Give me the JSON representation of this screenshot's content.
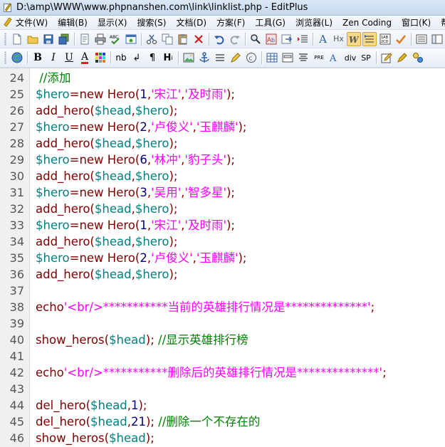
{
  "window": {
    "title": "D:\\amp\\WWW\\www.phpnanshen.com\\link\\linklist.php - EditPlus"
  },
  "menu": [
    "文件(W)",
    "编辑(B)",
    "显示(X)",
    "搜索(S)",
    "文档(D)",
    "方案(F)",
    "工具(G)",
    "浏览器(L)",
    "Zen Coding",
    "窗口(K)",
    "帮助"
  ],
  "toolbar_format": {
    "bold": "B",
    "italic": "I",
    "underline": "U",
    "font_color": "A",
    "nbsp": "nb",
    "break": "↲",
    "paragraph": "¶",
    "heading": "H",
    "pre": "PRE",
    "div": "div",
    "span": "SP",
    "hx": "Hx",
    "font_size": "A"
  },
  "editor": {
    "lines": [
      {
        "n": "24",
        "tokens": [
          {
            "t": " //添加",
            "c": "cmt"
          }
        ]
      },
      {
        "n": "25",
        "tokens": [
          {
            "t": "$hero",
            "c": "var"
          },
          {
            "t": "=",
            "c": "op"
          },
          {
            "t": "new Hero(",
            "c": "cls"
          },
          {
            "t": "1",
            "c": "num"
          },
          {
            "t": ",",
            "c": "op"
          },
          {
            "t": "'宋江'",
            "c": "str"
          },
          {
            "t": ",",
            "c": "op"
          },
          {
            "t": "'及时雨'",
            "c": "str"
          },
          {
            "t": ");",
            "c": "op"
          }
        ]
      },
      {
        "n": "26",
        "tokens": [
          {
            "t": "add_hero(",
            "c": "fn"
          },
          {
            "t": "$head",
            "c": "var"
          },
          {
            "t": ",",
            "c": "op"
          },
          {
            "t": "$hero",
            "c": "var"
          },
          {
            "t": ");",
            "c": "op"
          }
        ]
      },
      {
        "n": "27",
        "tokens": [
          {
            "t": "$hero",
            "c": "var"
          },
          {
            "t": "=",
            "c": "op"
          },
          {
            "t": "new Hero(",
            "c": "cls"
          },
          {
            "t": "2",
            "c": "num"
          },
          {
            "t": ",",
            "c": "op"
          },
          {
            "t": "'卢俊义'",
            "c": "str"
          },
          {
            "t": ",",
            "c": "op"
          },
          {
            "t": "'玉麒麟'",
            "c": "str"
          },
          {
            "t": ");",
            "c": "op"
          }
        ]
      },
      {
        "n": "28",
        "tokens": [
          {
            "t": "add_hero(",
            "c": "fn"
          },
          {
            "t": "$head",
            "c": "var"
          },
          {
            "t": ",",
            "c": "op"
          },
          {
            "t": "$hero",
            "c": "var"
          },
          {
            "t": ");",
            "c": "op"
          }
        ]
      },
      {
        "n": "29",
        "tokens": [
          {
            "t": "$hero",
            "c": "var"
          },
          {
            "t": "=",
            "c": "op"
          },
          {
            "t": "new Hero(",
            "c": "cls"
          },
          {
            "t": "6",
            "c": "num"
          },
          {
            "t": ",",
            "c": "op"
          },
          {
            "t": "'林冲'",
            "c": "str"
          },
          {
            "t": ",",
            "c": "op"
          },
          {
            "t": "'豹子头'",
            "c": "str"
          },
          {
            "t": ");",
            "c": "op"
          }
        ]
      },
      {
        "n": "30",
        "tokens": [
          {
            "t": "add_hero(",
            "c": "fn"
          },
          {
            "t": "$head",
            "c": "var"
          },
          {
            "t": ",",
            "c": "op"
          },
          {
            "t": "$hero",
            "c": "var"
          },
          {
            "t": ");",
            "c": "op"
          }
        ]
      },
      {
        "n": "31",
        "tokens": [
          {
            "t": "$hero",
            "c": "var"
          },
          {
            "t": "=",
            "c": "op"
          },
          {
            "t": "new Hero(",
            "c": "cls"
          },
          {
            "t": "3",
            "c": "num"
          },
          {
            "t": ",",
            "c": "op"
          },
          {
            "t": "'吴用'",
            "c": "str"
          },
          {
            "t": ",",
            "c": "op"
          },
          {
            "t": "'智多星'",
            "c": "str"
          },
          {
            "t": ");",
            "c": "op"
          }
        ]
      },
      {
        "n": "32",
        "tokens": [
          {
            "t": "add_hero(",
            "c": "fn"
          },
          {
            "t": "$head",
            "c": "var"
          },
          {
            "t": ",",
            "c": "op"
          },
          {
            "t": "$hero",
            "c": "var"
          },
          {
            "t": ");",
            "c": "op"
          }
        ]
      },
      {
        "n": "33",
        "tokens": [
          {
            "t": "$hero",
            "c": "var"
          },
          {
            "t": "=",
            "c": "op"
          },
          {
            "t": "new Hero(",
            "c": "cls"
          },
          {
            "t": "1",
            "c": "num"
          },
          {
            "t": ",",
            "c": "op"
          },
          {
            "t": "'宋江'",
            "c": "str"
          },
          {
            "t": ",",
            "c": "op"
          },
          {
            "t": "'及时雨'",
            "c": "str"
          },
          {
            "t": ");",
            "c": "op"
          }
        ]
      },
      {
        "n": "34",
        "tokens": [
          {
            "t": "add_hero(",
            "c": "fn"
          },
          {
            "t": "$head",
            "c": "var"
          },
          {
            "t": ",",
            "c": "op"
          },
          {
            "t": "$hero",
            "c": "var"
          },
          {
            "t": ");",
            "c": "op"
          }
        ]
      },
      {
        "n": "35",
        "tokens": [
          {
            "t": "$hero",
            "c": "var"
          },
          {
            "t": "=",
            "c": "op"
          },
          {
            "t": "new Hero(",
            "c": "cls"
          },
          {
            "t": "2",
            "c": "num"
          },
          {
            "t": ",",
            "c": "op"
          },
          {
            "t": "'卢俊义'",
            "c": "str"
          },
          {
            "t": ",",
            "c": "op"
          },
          {
            "t": "'玉麒麟'",
            "c": "str"
          },
          {
            "t": ");",
            "c": "op"
          }
        ]
      },
      {
        "n": "36",
        "tokens": [
          {
            "t": "add_hero(",
            "c": "fn"
          },
          {
            "t": "$head",
            "c": "var"
          },
          {
            "t": ",",
            "c": "op"
          },
          {
            "t": "$hero",
            "c": "var"
          },
          {
            "t": ");",
            "c": "op"
          }
        ]
      },
      {
        "n": "37",
        "tokens": []
      },
      {
        "n": "38",
        "tokens": [
          {
            "t": "echo",
            "c": "kw"
          },
          {
            "t": "'<br/>***********当前的英雄排行情况是**************'",
            "c": "str"
          },
          {
            "t": ";",
            "c": "op"
          }
        ]
      },
      {
        "n": "39",
        "tokens": []
      },
      {
        "n": "40",
        "tokens": [
          {
            "t": "show_heros(",
            "c": "fn"
          },
          {
            "t": "$head",
            "c": "var"
          },
          {
            "t": "); ",
            "c": "op"
          },
          {
            "t": "//显示英雄排行榜",
            "c": "cmt"
          }
        ]
      },
      {
        "n": "41",
        "tokens": []
      },
      {
        "n": "42",
        "tokens": [
          {
            "t": "echo",
            "c": "kw"
          },
          {
            "t": "'<br/>***********删除后的英雄排行情况是**************'",
            "c": "str"
          },
          {
            "t": ";",
            "c": "op"
          }
        ]
      },
      {
        "n": "43",
        "tokens": []
      },
      {
        "n": "44",
        "tokens": [
          {
            "t": "del_hero(",
            "c": "fn"
          },
          {
            "t": "$head",
            "c": "var"
          },
          {
            "t": ",",
            "c": "op"
          },
          {
            "t": "1",
            "c": "num"
          },
          {
            "t": ");",
            "c": "op"
          }
        ]
      },
      {
        "n": "45",
        "tokens": [
          {
            "t": "del_hero(",
            "c": "fn"
          },
          {
            "t": "$head",
            "c": "var"
          },
          {
            "t": ",",
            "c": "op"
          },
          {
            "t": "21",
            "c": "num"
          },
          {
            "t": "); ",
            "c": "op"
          },
          {
            "t": "//删除一个不存在的",
            "c": "cmt"
          }
        ]
      },
      {
        "n": "46",
        "tokens": [
          {
            "t": "show_heros(",
            "c": "fn"
          },
          {
            "t": "$head",
            "c": "var"
          },
          {
            "t": ");",
            "c": "op"
          }
        ]
      }
    ]
  }
}
